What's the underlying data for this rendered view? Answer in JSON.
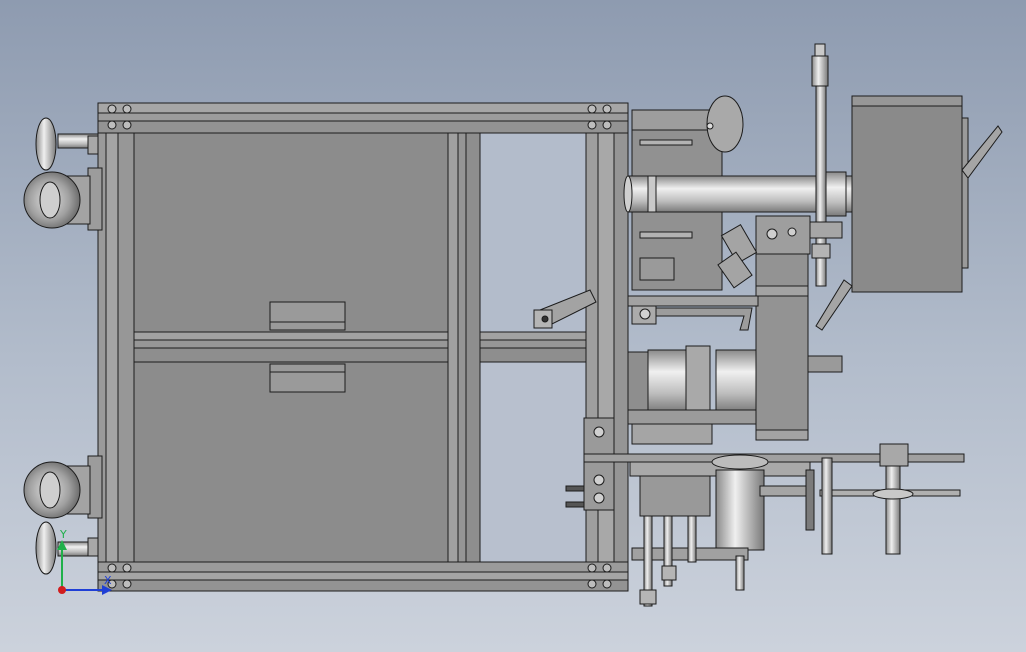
{
  "view": {
    "background_top": "#8e9bb0",
    "background_bottom": "#ccd2dc",
    "metal_color": "#8f8f8f",
    "metal_light": "#cfcfcf",
    "outline_color": "#1c1c1c"
  },
  "triad": {
    "x_axis_label": "X",
    "y_axis_label": "Y",
    "x_axis_color": "#1f3fd6",
    "y_axis_color": "#1fb04a",
    "origin_color": "#d11e1e"
  }
}
